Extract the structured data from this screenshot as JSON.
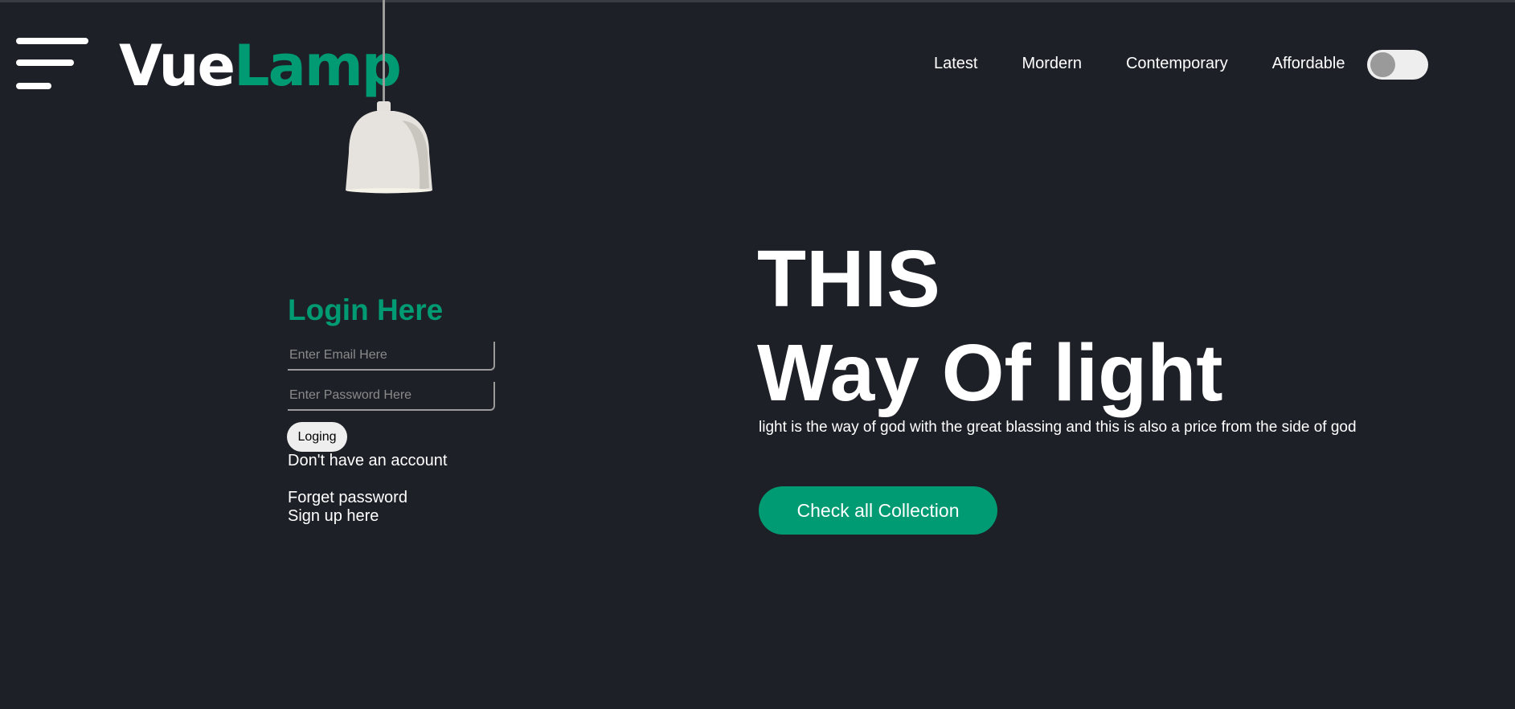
{
  "brand": {
    "logo_part1": "Vue",
    "logo_part2": "Lamp",
    "accent_color": "#009b72",
    "background_color": "#1e2028"
  },
  "header": {
    "menu_icon": "hamburger-menu-icon",
    "nav": [
      "Latest",
      "Mordern",
      "Contemporary",
      "Affordable"
    ],
    "theme_toggle": {
      "icon": "toggle-switch",
      "on": false
    }
  },
  "login": {
    "title": "Login Here",
    "email_placeholder": "Enter Email Here",
    "password_placeholder": "Enter Password Here",
    "submit_label": "Loging",
    "no_account_text": "Don't have an account",
    "forget_password_text": "Forget password",
    "signup_text": "Sign up here"
  },
  "hero": {
    "line1": "THIS",
    "line2": "Way Of light",
    "description": "light is the way of god with the great blassing and this is also a price from the side of god",
    "cta_label": "Check all Collection"
  }
}
